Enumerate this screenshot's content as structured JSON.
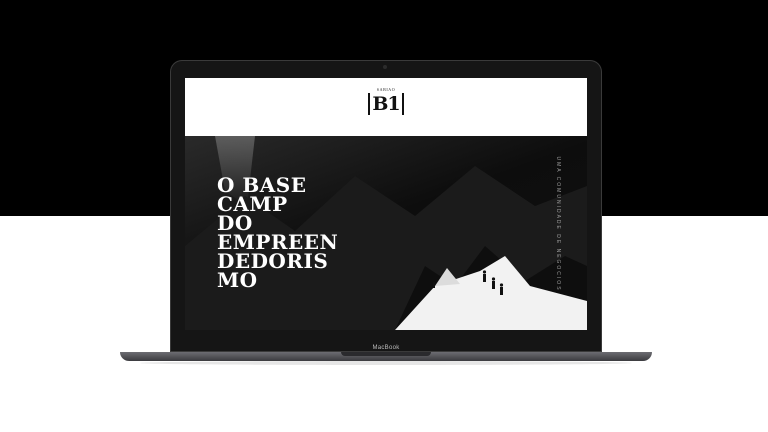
{
  "site": {
    "logo_small": "SABIAO",
    "logo_mark": "B1",
    "headline_lines": [
      "O BASE",
      "CAMP",
      "DO",
      "EMPREEN",
      "DEDORIS",
      "MO"
    ],
    "side_text": "UMA COMUNIDADE DE NEGOCIOS"
  },
  "device": {
    "brand_label": "MacBook"
  },
  "colors": {
    "background_top": "#000000",
    "background_bottom": "#ffffff",
    "header": "#ffffff",
    "text": "#ffffff"
  }
}
